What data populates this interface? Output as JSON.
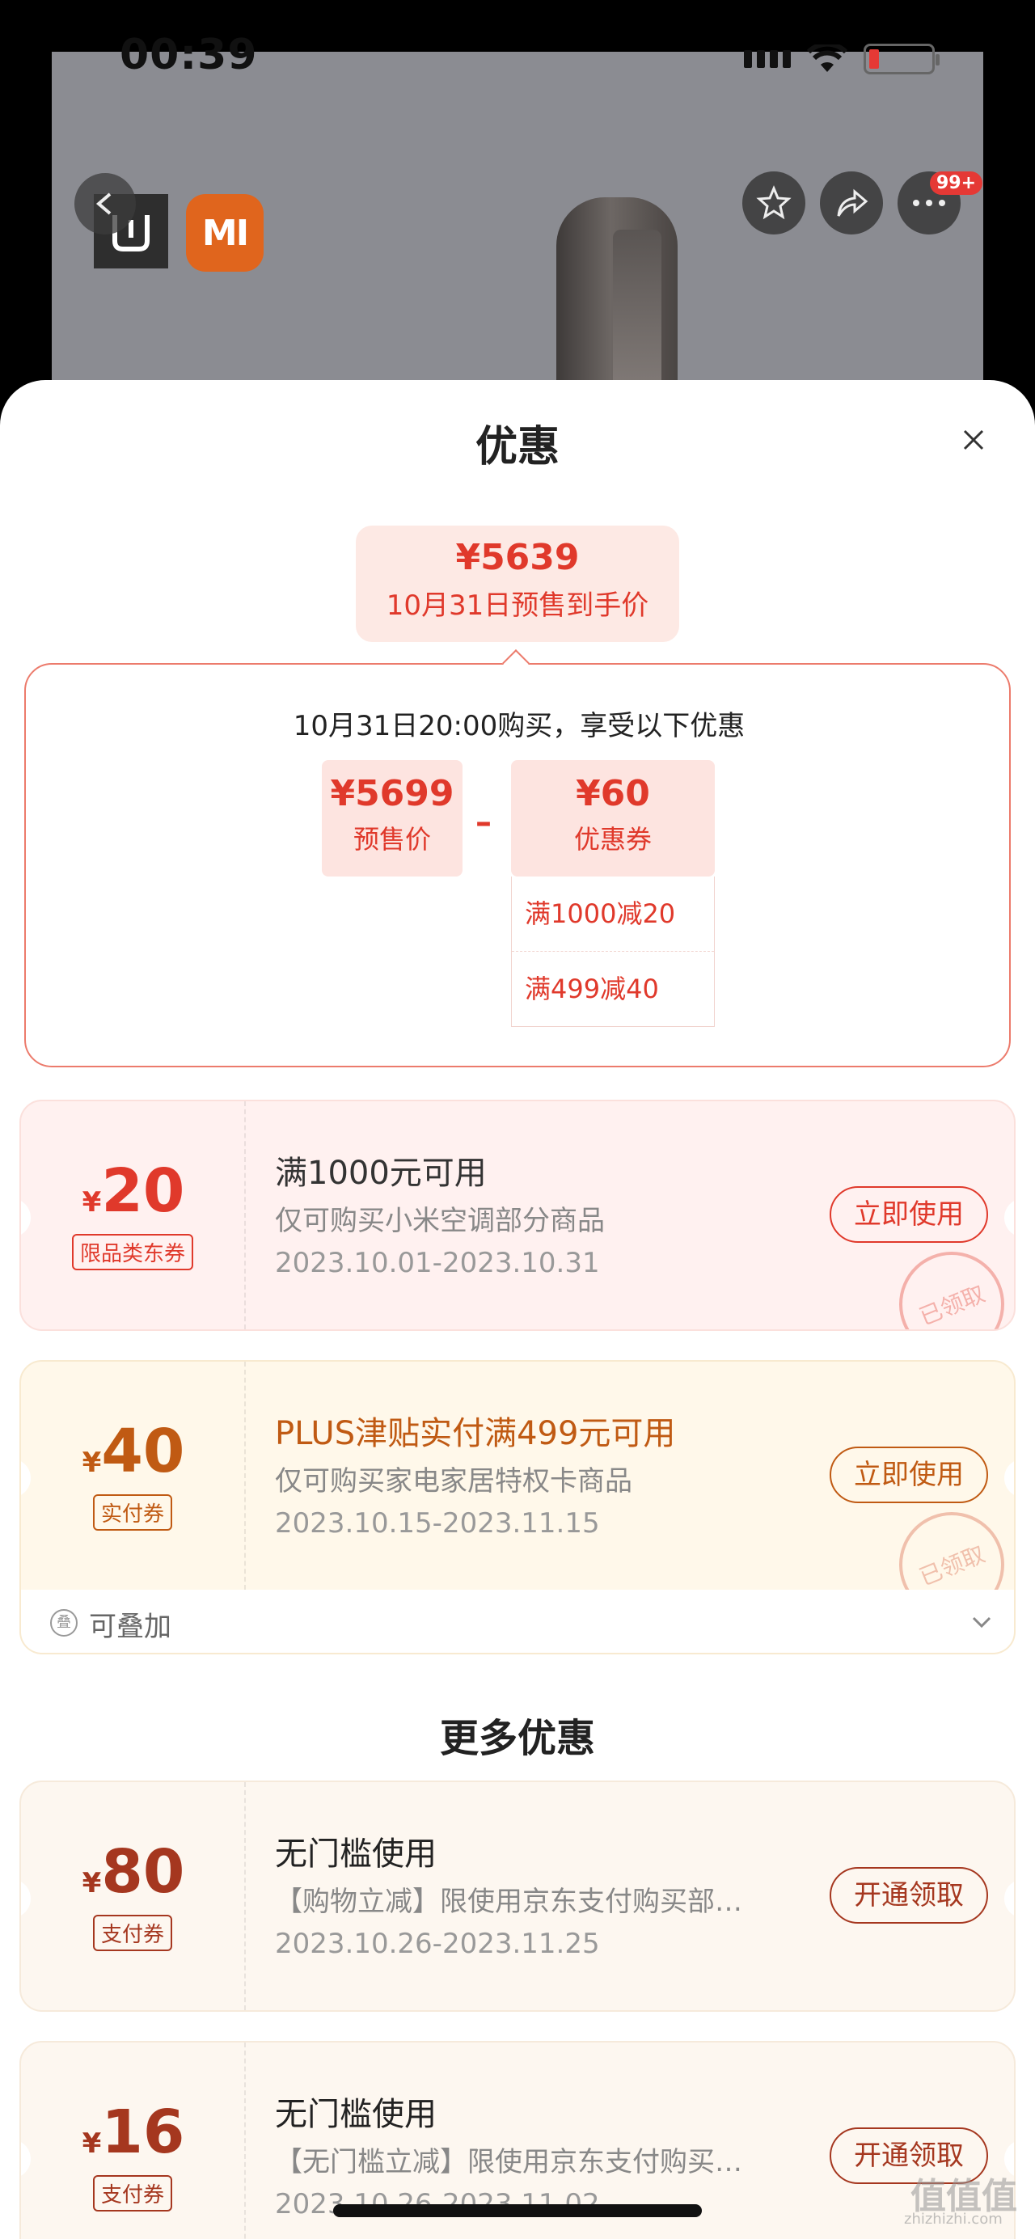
{
  "status_bar": {
    "time": "00:39"
  },
  "header": {
    "badge": "99+",
    "mi_logo": "MI"
  },
  "sheet": {
    "title": "优惠",
    "price_bubble": {
      "price": "¥5639",
      "label": "10月31日预售到手价"
    },
    "calc": {
      "title": "10月31日20:00购买，享受以下优惠",
      "presale_value": "¥5699",
      "presale_label": "预售价",
      "minus": "–",
      "coupon_value": "¥60",
      "coupon_label": "优惠券",
      "conditions": [
        "满1000减20",
        "满499减40"
      ]
    },
    "coupons": [
      {
        "yen": "¥",
        "amount": "20",
        "tag": "限品类东券",
        "title": "满1000元可用",
        "desc": "仅可购买小米空调部分商品",
        "date": "2023.10.01-2023.10.31",
        "button": "立即使用",
        "stamp": "已领取"
      },
      {
        "yen": "¥",
        "amount": "40",
        "tag": "实付券",
        "title": "PLUS津贴实付满499元可用",
        "desc": "仅可购买家电家居特权卡商品",
        "date": "2023.10.15-2023.11.15",
        "button": "立即使用",
        "stamp": "已领取"
      }
    ],
    "stack": {
      "label": "可叠加",
      "icon_char": "叠"
    },
    "more_title": "更多优惠",
    "more_coupons": [
      {
        "yen": "¥",
        "amount": "80",
        "tag": "支付券",
        "title": "无门槛使用",
        "desc": "【购物立减】限使用京东支付购买部…",
        "date": "2023.10.26-2023.11.25",
        "button": "开通领取"
      },
      {
        "yen": "¥",
        "amount": "16",
        "tag": "支付券",
        "title": "无门槛使用",
        "desc": "【无门槛立减】限使用京东支付购买…",
        "date": "2023.10.26-2023.11.02",
        "button": "开通领取"
      }
    ]
  },
  "watermark": {
    "text": "值值值",
    "sub": "zhizhizhi.com"
  },
  "colors": {
    "accent_red": "#e0392b",
    "gold": "#c05a13",
    "brown": "#a5371f",
    "mi_orange": "#e0651d"
  }
}
